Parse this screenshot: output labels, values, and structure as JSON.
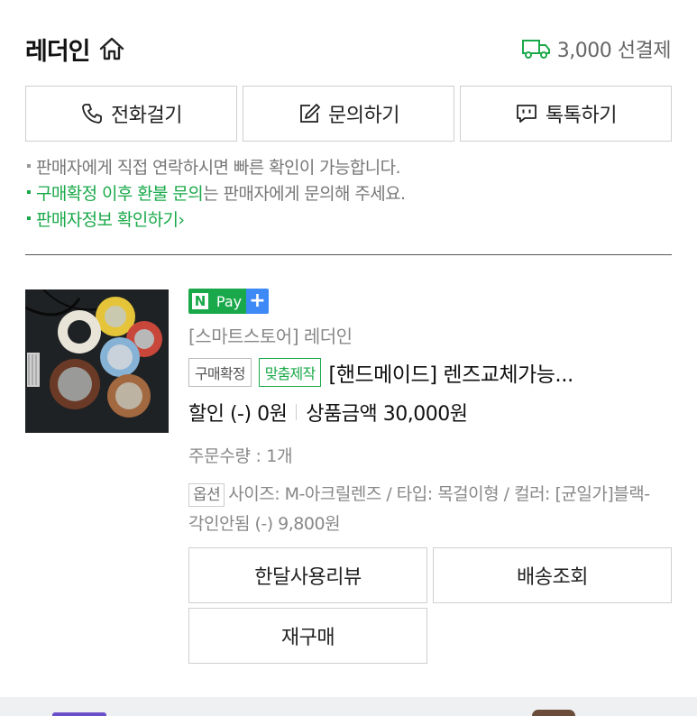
{
  "store": {
    "name": "레더인",
    "shipping_text": "3,000 선결제",
    "icons": {
      "home": "home-icon",
      "shipping": "truck-icon"
    }
  },
  "actions": [
    {
      "label": "전화걸기",
      "icon": "phone-icon"
    },
    {
      "label": "문의하기",
      "icon": "edit-icon"
    },
    {
      "label": "톡톡하기",
      "icon": "chat-icon"
    }
  ],
  "notes": {
    "line1": "판매자에게 직접 연락하시면 빠른 확인이 가능합니다.",
    "line2_highlight": "구매확정 이후 환불 문의",
    "line2_rest": "는 판매자에게 문의해 주세요.",
    "line3_link": "판매자정보 확인하기",
    "line3_arrow": "›"
  },
  "product": {
    "npay": {
      "n": "N",
      "pay": "Pay",
      "plus": "+"
    },
    "seller": "[스마트스토어] 레더인",
    "badges": [
      "구매확정",
      "맞춤제작"
    ],
    "title": "[핸드메이드] 렌즈교체가능...",
    "discount": "할인 (-) 0원",
    "price": "상품금액 30,000원",
    "quantity": "주문수량 : 1개",
    "option_tag": "옵션",
    "option_text": "사이즈: M-아크릴렌즈 / 타입: 목걸이형 / 컬러: [균일가]블랙-각인안됨 (-) 9,800원"
  },
  "buttons": {
    "review": "한달사용리뷰",
    "tracking": "배송조회",
    "rebuy": "재구매"
  },
  "colors": {
    "accent_green": "#1aa94a",
    "npay_blue": "#3d8af7"
  }
}
